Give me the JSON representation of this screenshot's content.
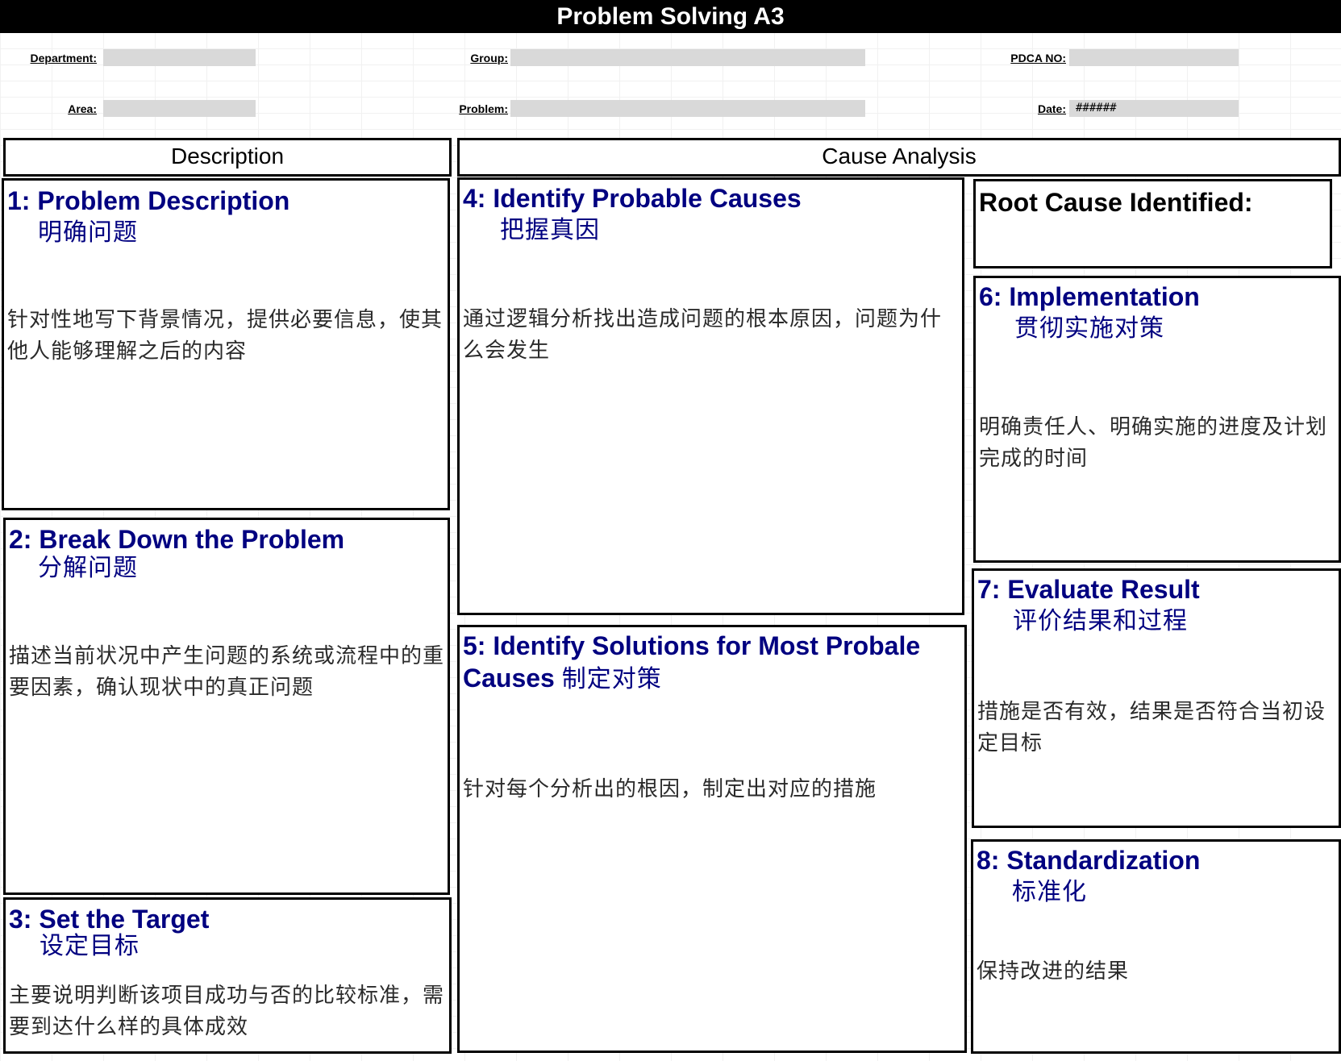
{
  "title": "Problem Solving A3",
  "header": {
    "department_label": "Department:",
    "department_value": "",
    "group_label": "Group:",
    "group_value": "",
    "pdca_label": "PDCA NO:",
    "pdca_value": "",
    "area_label": "Area:",
    "area_value": "",
    "problem_label": "Problem:",
    "problem_value": "",
    "date_label": "Date:",
    "date_value": "######"
  },
  "sections": {
    "description": "Description",
    "cause_analysis": "Cause Analysis"
  },
  "boxes": {
    "b1": {
      "title": "1: Problem Description",
      "subtitle": "明确问题",
      "body": "针对性地写下背景情况，提供必要信息，使其他人能够理解之后的内容"
    },
    "b2": {
      "title": "2: Break Down the Problem",
      "subtitle": "分解问题",
      "body": "描述当前状况中产生问题的系统或流程中的重要因素，确认现状中的真正问题"
    },
    "b3": {
      "title": "3: Set the Target",
      "subtitle": "设定目标",
      "body": "主要说明判断该项目成功与否的比较标准，需要到达什么样的具体成效"
    },
    "b4": {
      "title": "4:  Identify Probable Causes",
      "subtitle": "把握真因",
      "body": "通过逻辑分析找出造成问题的根本原因，问题为什么会发生"
    },
    "b5": {
      "title": "5:  Identify Solutions for Most Probale Causes",
      "subtitle": "制定对策",
      "body": "针对每个分析出的根因，制定出对应的措施"
    },
    "root": {
      "title": "Root Cause Identified:"
    },
    "b6": {
      "title": "6:  Implementation",
      "subtitle": "贯彻实施对策",
      "body": "明确责任人、明确实施的进度及计划完成的时间"
    },
    "b7": {
      "title": "7:  Evaluate Result",
      "subtitle": "评价结果和过程",
      "body": "措施是否有效，结果是否符合当初设定目标"
    },
    "b8": {
      "title": "8:  Standardization",
      "subtitle": "标准化",
      "body": "保持改进的结果"
    }
  },
  "colors": {
    "title_bar": "#000000",
    "heading_text": "#000080",
    "field_fill": "#d9d9d9"
  }
}
